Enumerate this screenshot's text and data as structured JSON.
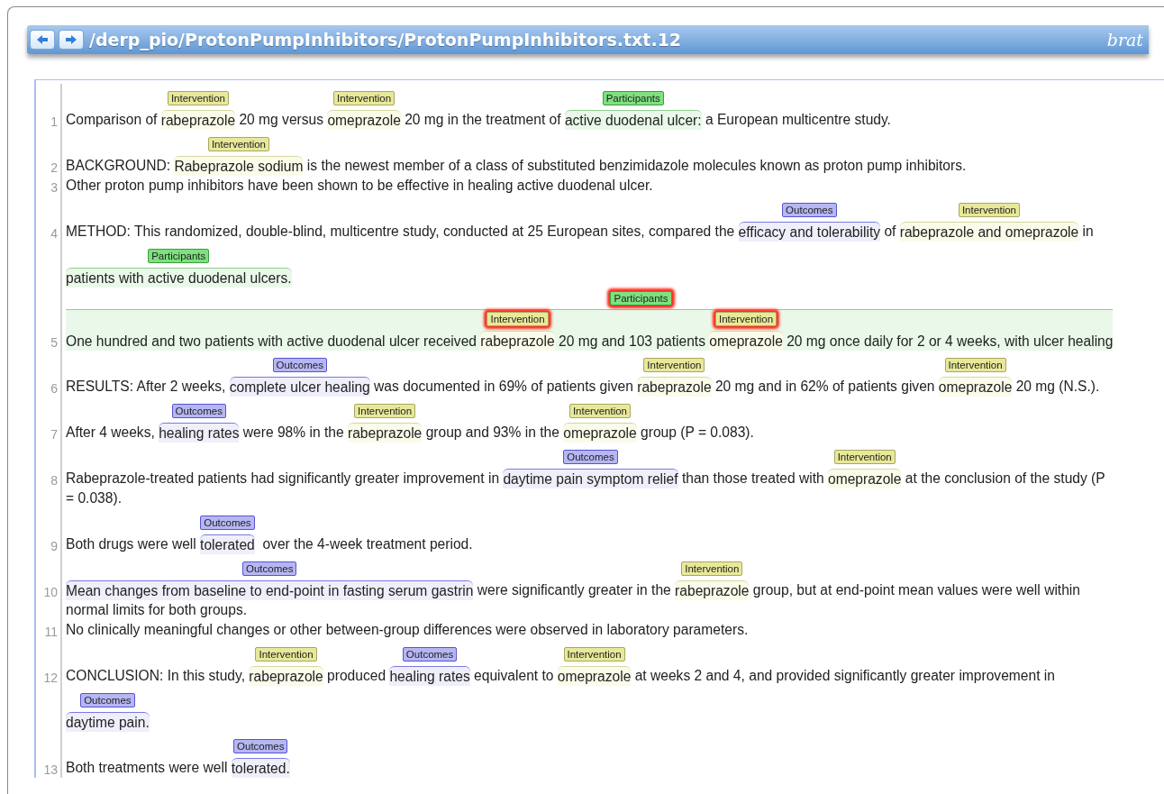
{
  "header": {
    "path": "/derp_pio/ProtonPumpInhibitors/ProtonPumpInhibitors.txt.12",
    "logo": "brat"
  },
  "sentences": [
    {
      "number": "1",
      "lines": [
        [
          {
            "text": "Comparison of "
          },
          {
            "text": "rabeprazole",
            "label": "Intervention",
            "kind": "intervention"
          },
          {
            "text": " 20 mg versus "
          },
          {
            "text": "omeprazole",
            "label": "Intervention",
            "kind": "intervention"
          },
          {
            "text": " 20 mg in the treatment of "
          },
          {
            "text": "active duodenal ulcer:",
            "label": "Participants",
            "kind": "participants"
          },
          {
            "text": " a European multicentre study."
          }
        ]
      ]
    },
    {
      "number": "2",
      "lines": [
        [
          {
            "text": "BACKGROUND: "
          },
          {
            "text": "Rabeprazole sodium",
            "label": "Intervention",
            "kind": "intervention"
          },
          {
            "text": " is the newest member of a class of substituted benzimidazole molecules known as proton pump inhibitors."
          }
        ]
      ]
    },
    {
      "number": "3",
      "lines": [
        [
          {
            "text": "Other proton pump inhibitors have been shown to be effective in healing active duodenal ulcer."
          }
        ]
      ]
    },
    {
      "number": "4",
      "lines": [
        [
          {
            "text": "METHOD: This randomized, double-blind, multicentre study, conducted at 25 European sites, compared the "
          },
          {
            "text": "efficacy and tolerability",
            "label": "Outcomes",
            "kind": "outcomes"
          },
          {
            "text": " of "
          },
          {
            "text": "rabeprazole and omeprazole",
            "label": "Intervention",
            "kind": "intervention"
          },
          {
            "text": " in"
          }
        ],
        [
          {
            "text": "patients with active duodenal ulcers.",
            "label": "Participants",
            "kind": "participants"
          }
        ]
      ]
    },
    {
      "number": "5",
      "lines": [
        [
          {
            "label": "Participants",
            "kind": "participants",
            "flagged": true,
            "segments": [
              {
                "text": "One hundred and two patients with active duodenal ulcer received "
              },
              {
                "text": "rabeprazole",
                "label": "Intervention",
                "kind": "intervention",
                "flagged": true
              },
              {
                "text": " 20 mg and 103 patients "
              },
              {
                "text": "omeprazole",
                "label": "Intervention",
                "kind": "intervention",
                "flagged": true
              },
              {
                "text": " 20 mg once daily for 2 or 4 weeks, with ulcer healing"
              }
            ]
          }
        ]
      ]
    },
    {
      "number": "6",
      "lines": [
        [
          {
            "text": "RESULTS: After 2 weeks, "
          },
          {
            "text": "complete ulcer healing",
            "label": "Outcomes",
            "kind": "outcomes"
          },
          {
            "text": " was documented in 69% of patients given "
          },
          {
            "text": "rabeprazole",
            "label": "Intervention",
            "kind": "intervention"
          },
          {
            "text": " 20 mg and in 62% of patients given "
          },
          {
            "text": "omeprazole",
            "label": "Intervention",
            "kind": "intervention"
          },
          {
            "text": " 20 mg (N.S.)."
          }
        ]
      ]
    },
    {
      "number": "7",
      "lines": [
        [
          {
            "text": "After 4 weeks, "
          },
          {
            "text": "healing rates",
            "label": "Outcomes",
            "kind": "outcomes"
          },
          {
            "text": " were 98% in the "
          },
          {
            "text": "rabeprazole",
            "label": "Intervention",
            "kind": "intervention"
          },
          {
            "text": " group and 93% in the "
          },
          {
            "text": "omeprazole",
            "label": "Intervention",
            "kind": "intervention"
          },
          {
            "text": " group (P = 0.083)."
          }
        ]
      ]
    },
    {
      "number": "8",
      "lines": [
        [
          {
            "text": "Rabeprazole-treated patients had significantly greater improvement in "
          },
          {
            "text": "daytime pain symptom relief",
            "label": "Outcomes",
            "kind": "outcomes"
          },
          {
            "text": " than those treated with "
          },
          {
            "text": "omeprazole",
            "label": "Intervention",
            "kind": "intervention"
          },
          {
            "text": " at the conclusion of the study (P"
          }
        ],
        [
          {
            "text": "= 0.038)."
          }
        ]
      ]
    },
    {
      "number": "9",
      "lines": [
        [
          {
            "text": "Both drugs were well "
          },
          {
            "text": "tolerated",
            "label": "Outcomes",
            "kind": "outcomes"
          },
          {
            "text": "  over the 4-week treatment period."
          }
        ]
      ]
    },
    {
      "number": "10",
      "lines": [
        [
          {
            "text": "Mean changes from baseline to end-point in fasting serum gastrin",
            "label": "Outcomes",
            "kind": "outcomes"
          },
          {
            "text": " were significantly greater in the "
          },
          {
            "text": "rabeprazole",
            "label": "Intervention",
            "kind": "intervention"
          },
          {
            "text": " group, but at end-point mean values were well within"
          }
        ],
        [
          {
            "text": "normal limits for both groups."
          }
        ]
      ]
    },
    {
      "number": "11",
      "lines": [
        [
          {
            "text": "No clinically meaningful changes or other between-group differences were observed in laboratory parameters."
          }
        ]
      ]
    },
    {
      "number": "12",
      "lines": [
        [
          {
            "text": "CONCLUSION: In this study, "
          },
          {
            "text": "rabeprazole",
            "label": "Intervention",
            "kind": "intervention"
          },
          {
            "text": " produced "
          },
          {
            "text": "healing rates",
            "label": "Outcomes",
            "kind": "outcomes"
          },
          {
            "text": " equivalent to "
          },
          {
            "text": "omeprazole",
            "label": "Intervention",
            "kind": "intervention"
          },
          {
            "text": " at weeks 2 and 4, and provided significantly greater improvement in"
          }
        ],
        [
          {
            "text": "daytime pain.",
            "label": "Outcomes",
            "kind": "outcomes"
          }
        ]
      ]
    },
    {
      "number": "13",
      "lines": [
        [
          {
            "text": "Both treatments were well "
          },
          {
            "text": "tolerated.",
            "label": "Outcomes",
            "kind": "outcomes"
          }
        ]
      ]
    }
  ]
}
